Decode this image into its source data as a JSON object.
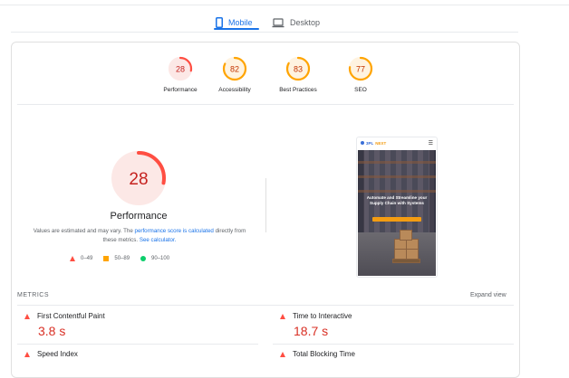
{
  "tabs": {
    "mobile_label": "Mobile",
    "desktop_label": "Desktop"
  },
  "scores": [
    {
      "key": "performance",
      "value": "28",
      "score": 28,
      "label": "Performance",
      "color": "#ff4e42",
      "track": "#fce8e6"
    },
    {
      "key": "accessibility",
      "value": "82",
      "score": 82,
      "label": "Accessibility",
      "color": "#ffa400",
      "track": "#fff3e0"
    },
    {
      "key": "best_practices",
      "value": "83",
      "score": 83,
      "label": "Best Practices",
      "color": "#ffa400",
      "track": "#fff3e0"
    },
    {
      "key": "seo",
      "value": "77",
      "score": 77,
      "label": "SEO",
      "color": "#ffa400",
      "track": "#fff3e0"
    }
  ],
  "main": {
    "score": "28",
    "score_fraction": 0.28,
    "title": "Performance",
    "note_prefix": "Values are estimated and may vary. The ",
    "note_link": "performance score is calculated",
    "note_mid": " directly from these metrics. ",
    "note_link2": "See calculator."
  },
  "legend": {
    "poor": "0–49",
    "average": "50–89",
    "good": "90–100"
  },
  "screenshot": {
    "logo_prefix": "3PL",
    "logo_accent": "NEXT",
    "menu_icon": "hamburger-icon",
    "hero_text": "Automate and Streamline your Supply Chain with Systems"
  },
  "metrics": {
    "section_title": "METRICS",
    "expand_label": "Expand view",
    "items": [
      {
        "name": "First Contentful Paint",
        "value": "3.8 s",
        "icon": "red-triangle-icon"
      },
      {
        "name": "Time to Interactive",
        "value": "18.7 s",
        "icon": "red-triangle-icon"
      },
      {
        "name": "Speed Index",
        "value": "",
        "icon": "red-triangle-icon"
      },
      {
        "name": "Total Blocking Time",
        "value": "",
        "icon": "red-triangle-icon"
      }
    ]
  },
  "colors": {
    "accent": "#1a73e8",
    "fail": "#ff4e42",
    "average": "#ffa400",
    "pass": "#0cce6b"
  }
}
